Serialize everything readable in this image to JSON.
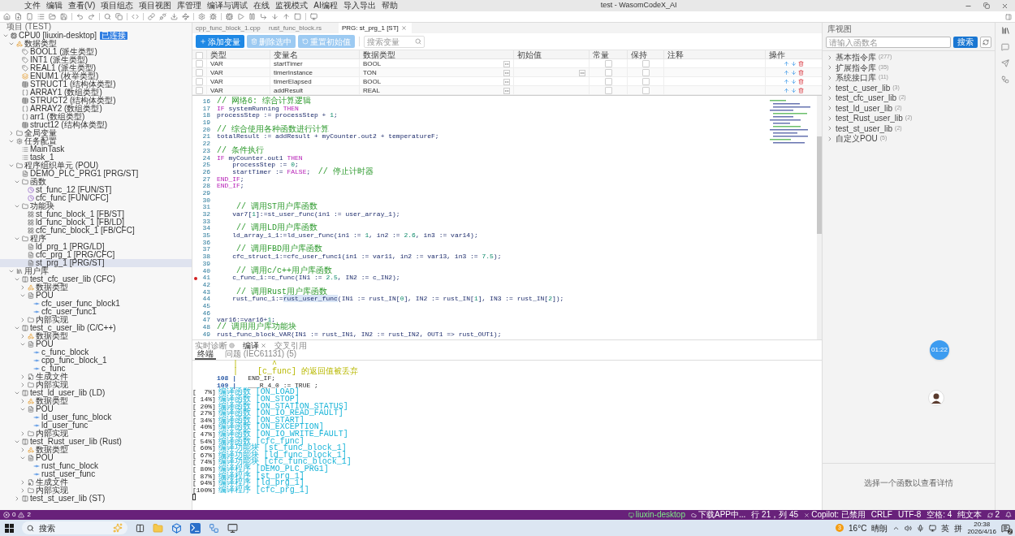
{
  "window": {
    "title": "test - WasomCodeX_AI"
  },
  "menu": [
    "文件",
    "编辑",
    "查看(V)",
    "项目组态",
    "项目视图",
    "库管理",
    "编译与调试",
    "在线",
    "监视模式",
    "AI编程",
    "导入导出",
    "帮助"
  ],
  "project": {
    "title": "项目 (TEST)",
    "tree": [
      {
        "label": "CPU0 [liuxin-desktop]",
        "kind": "device",
        "badge": "已连接",
        "selected": false,
        "expanded": true,
        "children": [
          {
            "label": "数据类型",
            "kind": "types",
            "selected": false,
            "expanded": true,
            "children": [
              {
                "label": "BOOL1 (派生类型)",
                "kind": "type",
                "selected": false
              },
              {
                "label": "INT1 (派生类型)",
                "kind": "type",
                "selected": false
              },
              {
                "label": "REAL1 (派生类型)",
                "kind": "type",
                "selected": false
              },
              {
                "label": "ENUM1 (枚举类型)",
                "kind": "enum",
                "selected": false
              },
              {
                "label": "STRUCT1 (结构体类型)",
                "kind": "struct",
                "selected": false
              },
              {
                "label": "ARRAY1 (数组类型)",
                "kind": "array",
                "selected": false
              },
              {
                "label": "STRUCT2 (结构体类型)",
                "kind": "struct",
                "selected": false
              },
              {
                "label": "ARRAY2 (数组类型)",
                "kind": "array",
                "selected": false
              },
              {
                "label": "arr1 (数组类型)",
                "kind": "array",
                "selected": false
              },
              {
                "label": "struct12 (结构体类型)",
                "kind": "struct",
                "selected": false
              }
            ]
          },
          {
            "label": "全局变量",
            "kind": "folder",
            "selected": false,
            "expanded": false
          },
          {
            "label": "任务配置",
            "kind": "config",
            "selected": false,
            "expanded": true,
            "children": [
              {
                "label": "MainTask",
                "kind": "task",
                "selected": false
              },
              {
                "label": "task_1",
                "kind": "task",
                "selected": false
              }
            ]
          },
          {
            "label": "程序组织单元 (POU)",
            "kind": "folder",
            "selected": false,
            "expanded": true,
            "children": [
              {
                "label": "DEMO_PLC_PRG1 [PRG/ST]",
                "kind": "program",
                "selected": false
              },
              {
                "label": "函数",
                "kind": "folder",
                "selected": false,
                "expanded": true,
                "children": [
                  {
                    "label": "st_func_12 [FUN/ST]",
                    "kind": "function",
                    "selected": false
                  },
                  {
                    "label": "cfc_func [FUN/CFC]",
                    "kind": "function",
                    "selected": false
                  }
                ]
              },
              {
                "label": "功能块",
                "kind": "folder",
                "selected": false,
                "expanded": true,
                "children": [
                  {
                    "label": "st_func_block_1 [FB/ST]",
                    "kind": "fb",
                    "selected": false
                  },
                  {
                    "label": "ld_func_block_1 [FB/LD]",
                    "kind": "fb",
                    "selected": false
                  },
                  {
                    "label": "cfc_func_block_1 [FB/CFC]",
                    "kind": "fb",
                    "selected": false
                  }
                ]
              },
              {
                "label": "程序",
                "kind": "folder",
                "selected": false,
                "expanded": true,
                "children": [
                  {
                    "label": "ld_prg_1 [PRG/LD]",
                    "kind": "program",
                    "selected": false
                  },
                  {
                    "label": "cfc_prg_1 [PRG/CFC]",
                    "kind": "program",
                    "selected": false
                  },
                  {
                    "label": "st_prg_1 [PRG/ST]",
                    "kind": "program",
                    "selected": true
                  }
                ]
              }
            ]
          },
          {
            "label": "用户库",
            "kind": "library",
            "selected": false,
            "expanded": true,
            "children": [
              {
                "label": "test_cfc_user_lib (CFC)",
                "kind": "lib",
                "selected": false,
                "expanded": true,
                "children": [
                  {
                    "label": "数据类型",
                    "kind": "types",
                    "selected": false,
                    "expanded": false
                  },
                  {
                    "label": "POU",
                    "kind": "program",
                    "selected": false,
                    "expanded": true,
                    "children": [
                      {
                        "label": "cfc_user_func_block1",
                        "kind": "entry",
                        "selected": false
                      },
                      {
                        "label": "cfc_user_func1",
                        "kind": "entry",
                        "selected": false
                      }
                    ]
                  },
                  {
                    "label": "内部实现",
                    "kind": "folder",
                    "selected": false,
                    "expanded": false
                  }
                ]
              },
              {
                "label": "test_c_user_lib (C/C++)",
                "kind": "lib",
                "selected": false,
                "expanded": true,
                "children": [
                  {
                    "label": "数据类型",
                    "kind": "types",
                    "selected": false,
                    "expanded": false
                  },
                  {
                    "label": "POU",
                    "kind": "program",
                    "selected": false,
                    "expanded": true,
                    "children": [
                      {
                        "label": "c_func_block",
                        "kind": "entry",
                        "selected": false
                      },
                      {
                        "label": "cpp_func_block_1",
                        "kind": "entry",
                        "selected": false
                      },
                      {
                        "label": "c_func",
                        "kind": "entry",
                        "selected": false
                      }
                    ]
                  },
                  {
                    "label": "生成文件",
                    "kind": "generated",
                    "selected": false,
                    "expanded": false
                  },
                  {
                    "label": "内部实现",
                    "kind": "folder",
                    "selected": false,
                    "expanded": false
                  }
                ]
              },
              {
                "label": "test_ld_user_lib (LD)",
                "kind": "lib",
                "selected": false,
                "expanded": true,
                "children": [
                  {
                    "label": "数据类型",
                    "kind": "types",
                    "selected": false,
                    "expanded": false
                  },
                  {
                    "label": "POU",
                    "kind": "program",
                    "selected": false,
                    "expanded": true,
                    "children": [
                      {
                        "label": "ld_user_func_block",
                        "kind": "entry",
                        "selected": false
                      },
                      {
                        "label": "ld_user_func",
                        "kind": "entry",
                        "selected": false
                      }
                    ]
                  },
                  {
                    "label": "内部实现",
                    "kind": "folder",
                    "selected": false,
                    "expanded": false
                  }
                ]
              },
              {
                "label": "test_Rust_user_lib (Rust)",
                "kind": "lib",
                "selected": false,
                "expanded": true,
                "children": [
                  {
                    "label": "数据类型",
                    "kind": "types",
                    "selected": false,
                    "expanded": false
                  },
                  {
                    "label": "POU",
                    "kind": "program",
                    "selected": false,
                    "expanded": true,
                    "children": [
                      {
                        "label": "rust_func_block",
                        "kind": "entry",
                        "selected": false
                      },
                      {
                        "label": "rust_user_func",
                        "kind": "entry",
                        "selected": false
                      }
                    ]
                  },
                  {
                    "label": "生成文件",
                    "kind": "generated",
                    "selected": false,
                    "expanded": false
                  },
                  {
                    "label": "内部实现",
                    "kind": "folder",
                    "selected": false,
                    "expanded": false
                  }
                ]
              },
              {
                "label": "test_st_user_lib (ST)",
                "kind": "lib",
                "selected": false,
                "expanded": false
              }
            ]
          }
        ]
      }
    ]
  },
  "editor": {
    "tabs": [
      {
        "label": "cpp_func_block_1.cpp",
        "selected": false,
        "closable": false
      },
      {
        "label": "rust_func_block.rs",
        "selected": false,
        "closable": false
      },
      {
        "label": "PRG: st_prg_1 [ST]",
        "selected": true,
        "closable": true
      }
    ],
    "buttons": [
      {
        "label": "添加变量",
        "kind": "add",
        "disabled": false
      },
      {
        "label": "删除选中",
        "kind": "delete",
        "disabled": true
      },
      {
        "label": "重置初始值",
        "kind": "reset",
        "disabled": true
      }
    ],
    "search": {
      "placeholder": "搜索变量"
    },
    "table": {
      "all_checked": false,
      "columns": [
        "类型",
        "变量名",
        "数据类型",
        "初始值",
        "常量",
        "保持",
        "注释",
        "操作"
      ],
      "rows": [
        {
          "checked": false,
          "type": "VAR",
          "name": "startTimer",
          "data_type": "BOOL",
          "init_picker": false,
          "constant": false,
          "retain": false
        },
        {
          "checked": false,
          "type": "VAR",
          "name": "timerInstance",
          "data_type": "TON",
          "init_picker": true,
          "constant": false,
          "retain": false
        },
        {
          "checked": false,
          "type": "VAR",
          "name": "timerElapsed",
          "data_type": "BOOL",
          "init_picker": false,
          "constant": false,
          "retain": false
        },
        {
          "checked": false,
          "type": "VAR",
          "name": "addResult",
          "data_type": "REAL",
          "init_picker": false,
          "constant": false,
          "retain": false
        }
      ]
    },
    "code": [
      {
        "no": "16",
        "breakpoint": false,
        "tokens": [
          {
            "kind": "comment",
            "text": "// 网络6: 综合计算逻辑"
          }
        ]
      },
      {
        "no": "17",
        "breakpoint": false,
        "tokens": [
          {
            "kind": "kw",
            "text": "IF"
          },
          {
            "kind": "plain",
            "text": " systemRunning "
          },
          {
            "kind": "kw",
            "text": "THEN"
          }
        ]
      },
      {
        "no": "18",
        "breakpoint": false,
        "tokens": [
          {
            "kind": "plain",
            "text": "processStep := processStep + "
          },
          {
            "kind": "num",
            "text": "1"
          },
          {
            "kind": "plain",
            "text": ";"
          }
        ]
      },
      {
        "no": "19",
        "breakpoint": false
      },
      {
        "no": "20",
        "breakpoint": false,
        "tokens": [
          {
            "kind": "comment",
            "text": "// 综合使用各种函数进行计算"
          }
        ]
      },
      {
        "no": "21",
        "breakpoint": false,
        "tokens": [
          {
            "kind": "plain",
            "text": "totalResult := addResult + myCounter.out2 + temperatureF;"
          }
        ]
      },
      {
        "no": "22",
        "breakpoint": false
      },
      {
        "no": "23",
        "breakpoint": false,
        "tokens": [
          {
            "kind": "comment",
            "text": "// 条件执行"
          }
        ]
      },
      {
        "no": "24",
        "breakpoint": false,
        "tokens": [
          {
            "kind": "kw",
            "text": "IF"
          },
          {
            "kind": "plain",
            "text": " myCounter.out1 "
          },
          {
            "kind": "kw",
            "text": "THEN"
          }
        ]
      },
      {
        "no": "25",
        "breakpoint": false,
        "tokens": [
          {
            "kind": "plain",
            "text": "    processStep := "
          },
          {
            "kind": "num",
            "text": "0"
          },
          {
            "kind": "plain",
            "text": ";"
          }
        ]
      },
      {
        "no": "26",
        "breakpoint": false,
        "tokens": [
          {
            "kind": "plain",
            "text": "    startTimer := "
          },
          {
            "kind": "kw",
            "text": "FALSE"
          },
          {
            "kind": "plain",
            "text": ";  "
          },
          {
            "kind": "comment",
            "text": "// 停止计时器"
          }
        ]
      },
      {
        "no": "27",
        "breakpoint": false,
        "tokens": [
          {
            "kind": "kw",
            "text": "END_IF"
          },
          {
            "kind": "plain",
            "text": ";"
          }
        ]
      },
      {
        "no": "28",
        "breakpoint": false,
        "tokens": [
          {
            "kind": "kw",
            "text": "END_IF"
          },
          {
            "kind": "plain",
            "text": ";"
          }
        ]
      },
      {
        "no": "29",
        "breakpoint": false
      },
      {
        "no": "30",
        "breakpoint": false
      },
      {
        "no": "31",
        "breakpoint": false,
        "tokens": [
          {
            "kind": "comment",
            "text": "    // 调用ST用户库函数"
          }
        ]
      },
      {
        "no": "32",
        "breakpoint": false,
        "tokens": [
          {
            "kind": "plain",
            "text": "    var7["
          },
          {
            "kind": "num",
            "text": "1"
          },
          {
            "kind": "plain",
            "text": "]:=st_user_func(in1 := user_array_1);"
          }
        ]
      },
      {
        "no": "33",
        "breakpoint": false
      },
      {
        "no": "34",
        "breakpoint": false,
        "tokens": [
          {
            "kind": "comment",
            "text": "    // 调用LD用户库函数"
          }
        ]
      },
      {
        "no": "35",
        "breakpoint": false,
        "tokens": [
          {
            "kind": "plain",
            "text": "    ld_array_1_1:=ld_user_func(in1 := "
          },
          {
            "kind": "num",
            "text": "1"
          },
          {
            "kind": "plain",
            "text": ", in2 := "
          },
          {
            "kind": "num",
            "text": "2.6"
          },
          {
            "kind": "plain",
            "text": ", in3 := var14);"
          }
        ]
      },
      {
        "no": "36",
        "breakpoint": false
      },
      {
        "no": "37",
        "breakpoint": false,
        "tokens": [
          {
            "kind": "comment",
            "text": "    // 调用FBD用户库函数"
          }
        ]
      },
      {
        "no": "38",
        "breakpoint": false,
        "tokens": [
          {
            "kind": "plain",
            "text": "    cfc_struct_1:=cfc_user_func1(in1 := var11, in2 := var13, in3 := "
          },
          {
            "kind": "num",
            "text": "7.5"
          },
          {
            "kind": "plain",
            "text": ");"
          }
        ]
      },
      {
        "no": "39",
        "breakpoint": false
      },
      {
        "no": "40",
        "breakpoint": false,
        "tokens": [
          {
            "kind": "comment",
            "text": "    // 调用c/c++用户库函数"
          }
        ]
      },
      {
        "no": "41",
        "breakpoint": true,
        "tokens": [
          {
            "kind": "plain",
            "text": "    c_func_1:=c_func(IN1 := "
          },
          {
            "kind": "num",
            "text": "2.5"
          },
          {
            "kind": "plain",
            "text": ", IN2 := c_IN2);"
          }
        ]
      },
      {
        "no": "42",
        "breakpoint": false
      },
      {
        "no": "43",
        "breakpoint": false,
        "tokens": [
          {
            "kind": "comment",
            "text": "    // 调用Rust用户库函数"
          }
        ]
      },
      {
        "no": "44",
        "breakpoint": false,
        "tokens": [
          {
            "kind": "plain",
            "text": "    rust_func_1:="
          },
          {
            "kind": "hl",
            "text": "rust_user_func"
          },
          {
            "kind": "plain",
            "text": "(IN1 := rust_IN["
          },
          {
            "kind": "num",
            "text": "0"
          },
          {
            "kind": "plain",
            "text": "], IN2 := rust_IN["
          },
          {
            "kind": "num",
            "text": "1"
          },
          {
            "kind": "plain",
            "text": "], IN3 := rust_IN["
          },
          {
            "kind": "num",
            "text": "2"
          },
          {
            "kind": "plain",
            "text": "]);"
          }
        ]
      },
      {
        "no": "45",
        "breakpoint": false
      },
      {
        "no": "46",
        "breakpoint": false
      },
      {
        "no": "47",
        "breakpoint": false,
        "tokens": [
          {
            "kind": "plain",
            "text": "var16:=var16+"
          },
          {
            "kind": "num",
            "text": "1"
          },
          {
            "kind": "plain",
            "text": ";"
          }
        ]
      },
      {
        "no": "48",
        "breakpoint": false,
        "tokens": [
          {
            "kind": "comment",
            "text": "// 调用用户库功能块"
          }
        ]
      },
      {
        "no": "49",
        "breakpoint": false,
        "tokens": [
          {
            "kind": "plain",
            "text": "rust_func_block_VAR(IN1 := rust_IN1, IN2 := rust_IN2, OUT1 => rust_OUT1);"
          }
        ]
      }
    ]
  },
  "bottom_panel": {
    "tabs": [
      {
        "label": "实时诊断",
        "kind": "diagnostic",
        "selected": false,
        "closable": false
      },
      {
        "label": "编译",
        "kind": "build",
        "selected": true,
        "closable": true
      },
      {
        "label": "交叉引用",
        "kind": "xref",
        "selected": false,
        "closable": false
      }
    ],
    "sub_tabs": [
      {
        "label": "终端",
        "selected": true
      },
      {
        "label": "问题 (IEC61131) (5)",
        "selected": false
      }
    ],
    "terminal": [
      {
        "kind": "note",
        "text": "|       ^"
      },
      {
        "kind": "note",
        "text": "|    [c_func] 的返回值被丢弃"
      },
      {
        "kind": "source",
        "no": "108 |",
        "text": "   END_IF;"
      },
      {
        "kind": "source",
        "no": "109 |",
        "text": "   ___R_4_0 := TRUE ;"
      },
      {
        "kind": "progress",
        "percent": "[  7%]",
        "text": "编译函数 [ON_LOAD]"
      },
      {
        "kind": "progress",
        "percent": "[ 14%]",
        "text": "编译函数 [ON_STOP]"
      },
      {
        "kind": "progress",
        "percent": "[ 20%]",
        "text": "编译函数 [ON_STATION_STATUS]"
      },
      {
        "kind": "progress",
        "percent": "[ 27%]",
        "text": "编译函数 [ON_IO_READ_FAULT]"
      },
      {
        "kind": "progress",
        "percent": "[ 34%]",
        "text": "编译函数 [ON_START]"
      },
      {
        "kind": "progress",
        "percent": "[ 40%]",
        "text": "编译函数 [ON_EXCEPTION]"
      },
      {
        "kind": "progress",
        "percent": "[ 47%]",
        "text": "编译函数 [ON_IO_WRITE_FAULT]"
      },
      {
        "kind": "progress",
        "percent": "[ 54%]",
        "text": "编译函数 [cfc_func]"
      },
      {
        "kind": "progress",
        "percent": "[ 60%]",
        "text": "编译功能块 [st_func_block_1]"
      },
      {
        "kind": "progress",
        "percent": "[ 67%]",
        "text": "编译功能块 [ld_func_block_1]"
      },
      {
        "kind": "progress",
        "percent": "[ 74%]",
        "text": "编译功能块 [cfc_func_block_1]"
      },
      {
        "kind": "progress",
        "percent": "[ 80%]",
        "text": "编译程序 [DEMO_PLC_PRG1]"
      },
      {
        "kind": "progress",
        "percent": "[ 87%]",
        "text": "编译程序 [st_prg_1]"
      },
      {
        "kind": "progress",
        "percent": "[ 94%]",
        "text": "编译程序 [ld_prg_1]"
      },
      {
        "kind": "progress",
        "percent": "[100%]",
        "text": "编译程序 [cfc_prg_1]"
      }
    ]
  },
  "library": {
    "title": "库视图",
    "search": {
      "placeholder": "请输入函数名"
    },
    "search_button": "搜索",
    "items": [
      {
        "label": "基本指令库",
        "count": "(277)",
        "expanded": false
      },
      {
        "label": "扩展指令库",
        "count": "(35)",
        "expanded": false
      },
      {
        "label": "系统接口库",
        "count": "(11)",
        "expanded": false
      },
      {
        "label": "test_c_user_lib",
        "count": "(3)",
        "expanded": false
      },
      {
        "label": "test_cfc_user_lib",
        "count": "(2)",
        "expanded": false
      },
      {
        "label": "test_ld_user_lib",
        "count": "(2)",
        "expanded": false
      },
      {
        "label": "test_Rust_user_lib",
        "count": "(2)",
        "expanded": false
      },
      {
        "label": "test_st_user_lib",
        "count": "(2)",
        "expanded": false
      },
      {
        "label": "自定义POU",
        "count": "(5)",
        "expanded": false
      }
    ],
    "hint": "选择一个函数以查看详情"
  },
  "timer": {
    "label": "01:22"
  },
  "status_bar": {
    "errors": "0",
    "warnings": "2",
    "items": [
      {
        "kind": "remote",
        "text": "liuxin-desktop"
      },
      {
        "kind": "cloud",
        "text": "下载APP中..."
      },
      {
        "kind": "text",
        "text": "行 21，列 45"
      },
      {
        "kind": "copilot",
        "text": "Copilot: 已禁用"
      },
      {
        "kind": "text",
        "text": "CRLF"
      },
      {
        "kind": "text",
        "text": "UTF-8"
      },
      {
        "kind": "text",
        "text": "空格: 4"
      },
      {
        "kind": "text",
        "text": "纯文本"
      },
      {
        "kind": "sync",
        "text": "2"
      }
    ]
  },
  "taskbar": {
    "search": "搜索",
    "weather": {
      "badge": "3",
      "temperature": "16°C",
      "condition": "晴朗"
    },
    "ime": [
      "英",
      "拼"
    ],
    "time": "20:38",
    "date": "2026/4/16",
    "notifications": "2"
  }
}
